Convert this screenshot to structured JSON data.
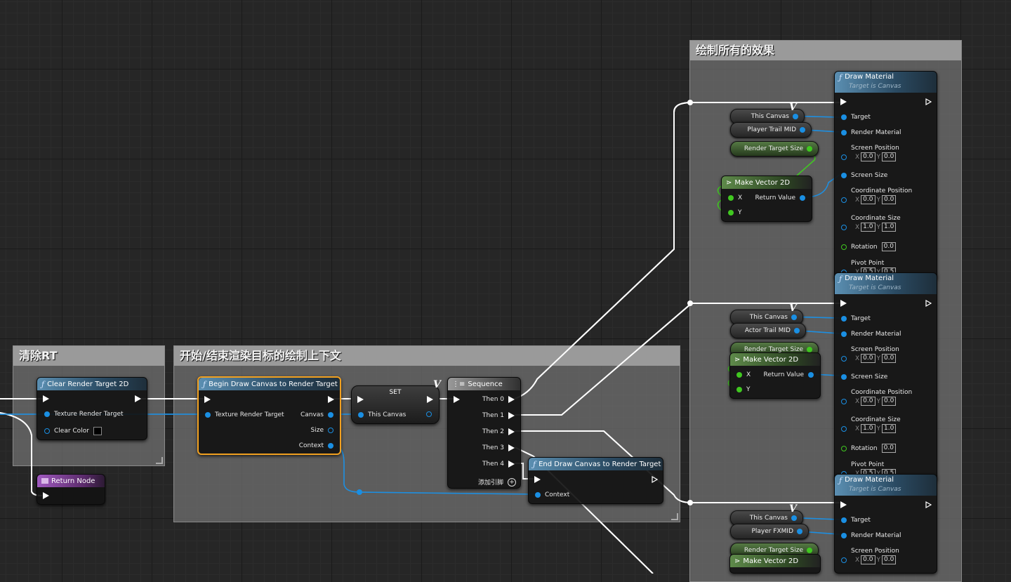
{
  "comments": {
    "clear_rt": "清除RT",
    "begin_end": "开始/结束渲染目标的绘制上下文",
    "draw_all": "绘制所有的效果"
  },
  "clear_node": {
    "title": "Clear Render Target 2D",
    "texture_pin": "Texture Render Target",
    "clear_color_pin": "Clear Color",
    "clear_color_value": "#000000"
  },
  "return_node": {
    "title": "Return Node"
  },
  "begin_node": {
    "title": "Begin Draw Canvas to Render Target",
    "texture_pin": "Texture Render Target",
    "canvas_pin": "Canvas",
    "size_pin": "Size",
    "context_pin": "Context"
  },
  "set_node": {
    "title": "SET",
    "var_pin": "This Canvas"
  },
  "sequence_node": {
    "title": "Sequence",
    "outputs": [
      "Then 0",
      "Then 1",
      "Then 2",
      "Then 3",
      "Then 4"
    ],
    "add_pin": "添加引脚"
  },
  "end_node": {
    "title": "End Draw Canvas to Render Target",
    "context_pin": "Context"
  },
  "draw_nodes": [
    {
      "title": "Draw Material",
      "subtitle": "Target is Canvas",
      "target": "Target",
      "render_material": "Render Material",
      "screen_position": "Screen Position",
      "screen_position_x": "0.0",
      "screen_position_y": "0.0",
      "screen_size": "Screen Size",
      "coordinate_position": "Coordinate Position",
      "coord_pos_x": "0.0",
      "coord_pos_y": "0.0",
      "coordinate_size": "Coordinate Size",
      "coord_size_x": "1.0",
      "coord_size_y": "1.0",
      "rotation": "Rotation",
      "rotation_value": "0.0",
      "pivot_point": "Pivot Point",
      "pivot_x": "0.5",
      "pivot_y": "0.5"
    },
    {
      "title": "Draw Material",
      "subtitle": "Target is Canvas",
      "target": "Target",
      "render_material": "Render Material",
      "screen_position": "Screen Position",
      "screen_position_x": "0.0",
      "screen_position_y": "0.0",
      "screen_size": "Screen Size",
      "coordinate_position": "Coordinate Position",
      "coord_pos_x": "0.0",
      "coord_pos_y": "0.0",
      "coordinate_size": "Coordinate Size",
      "coord_size_x": "1.0",
      "coord_size_y": "1.0",
      "rotation": "Rotation",
      "rotation_value": "0.0",
      "pivot_point": "Pivot Point",
      "pivot_x": "0.5",
      "pivot_y": "0.5"
    },
    {
      "title": "Draw Material",
      "subtitle": "Target is Canvas",
      "target": "Target",
      "render_material": "Render Material",
      "screen_position": "Screen Position",
      "screen_position_x": "0.0",
      "screen_position_y": "0.0"
    }
  ],
  "vars": {
    "this_canvas": "This Canvas",
    "player_trail_mid": "Player Trail MID",
    "actor_trail_mid": "Actor Trail MID",
    "player_fxmid": "Player FXMID",
    "render_target_size": "Render Target Size"
  },
  "make_vector": {
    "title": "Make Vector 2D",
    "x": "X",
    "y": "Y",
    "return_value": "Return Value"
  },
  "axis": {
    "x": "X",
    "y": "Y"
  },
  "colors": {
    "exec_wire": "#ffffff",
    "object_pin": "#1a8fe3",
    "struct_pin": "#40c820",
    "selected_outline": "#f0a020"
  }
}
